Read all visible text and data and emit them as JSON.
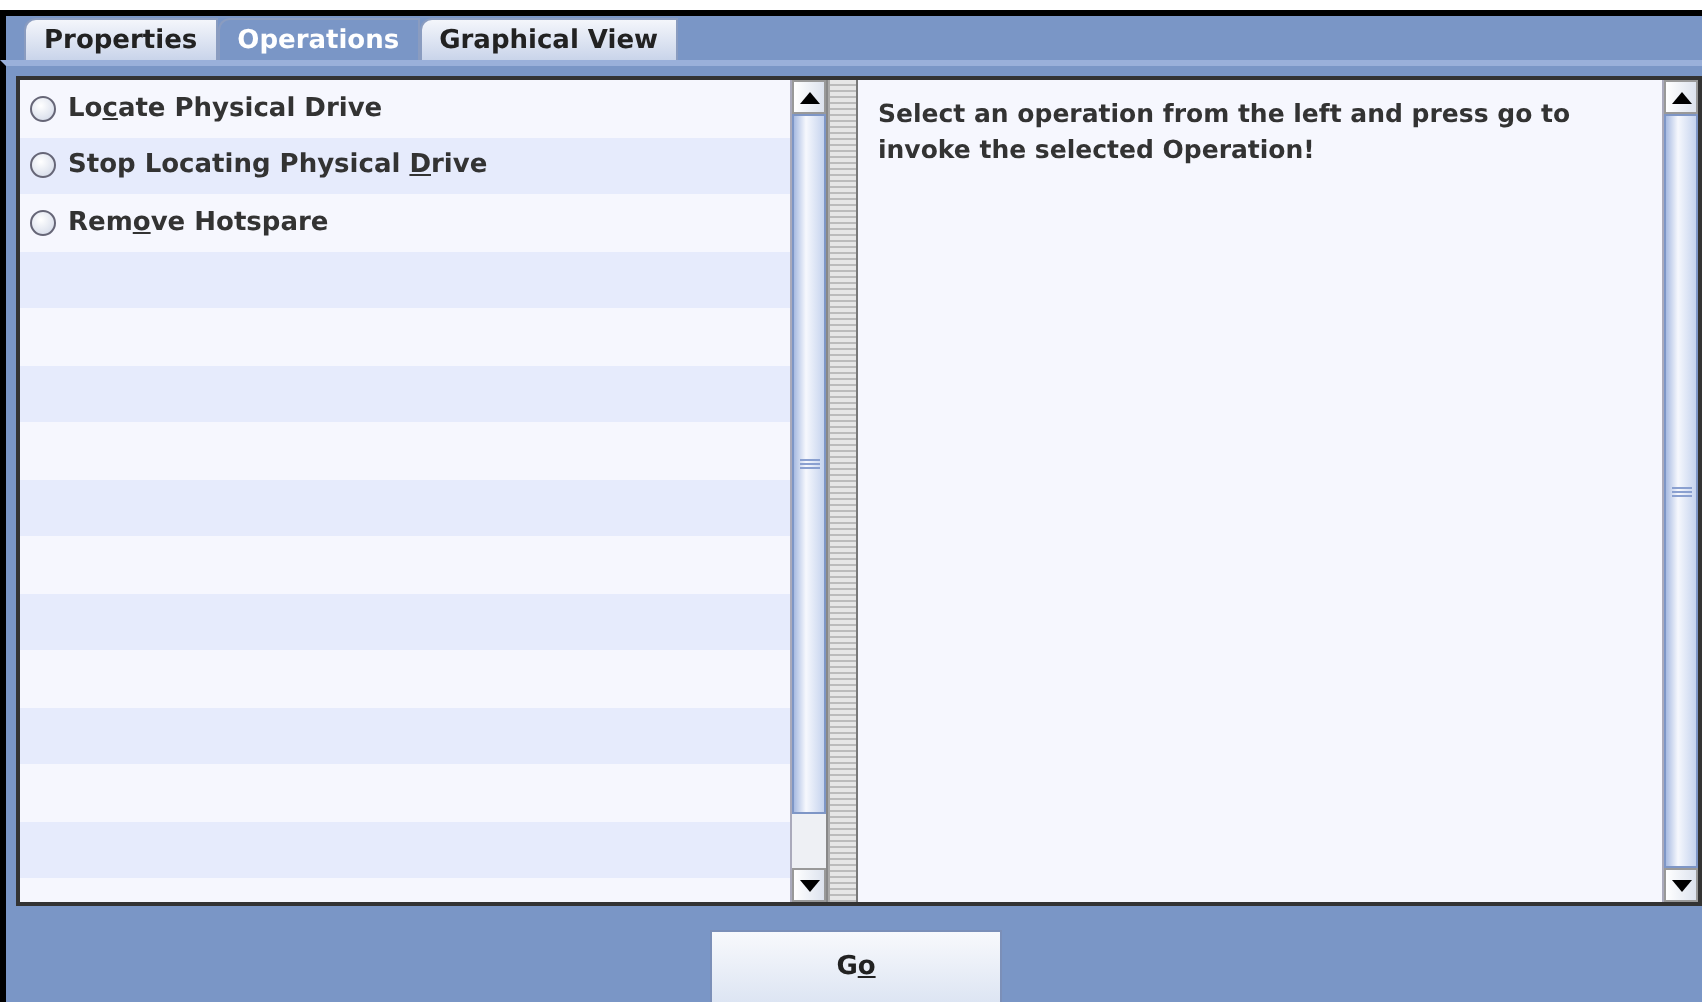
{
  "tabs": [
    {
      "label": "Properties",
      "selected": false
    },
    {
      "label": "Operations",
      "selected": true
    },
    {
      "label": "Graphical View",
      "selected": false
    }
  ],
  "operations": [
    {
      "label": {
        "before": "Lo",
        "mnemonic": "c",
        "after": "ate Physical Drive"
      },
      "selected": false
    },
    {
      "label": {
        "before": "Stop Locating Physical ",
        "mnemonic": "D",
        "after": "rive"
      },
      "selected": false
    },
    {
      "label": {
        "before": "Rem",
        "mnemonic": "o",
        "after": "ve Hotspare"
      },
      "selected": false
    }
  ],
  "description": "Select an operation from the left and press go to invoke the selected Operation!",
  "go_button": {
    "label": {
      "before": "G",
      "mnemonic": "o"
    }
  }
}
